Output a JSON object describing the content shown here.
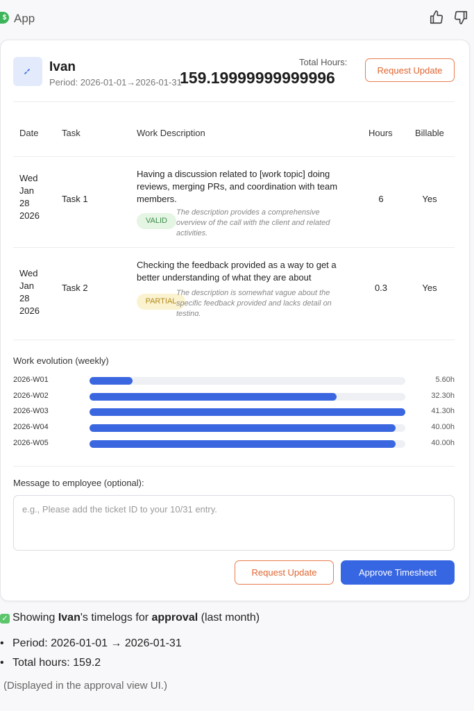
{
  "app": {
    "name": "App",
    "logo_letter": "$"
  },
  "header": {
    "employee_name": "Ivan",
    "period": "Period: 2026-01-01→2026-01-31",
    "total_label": "Total Hours:",
    "total_value": "159.19999999999996",
    "request_update_label": "Request Update"
  },
  "table": {
    "columns": [
      "Date",
      "Task",
      "Work Description",
      "Hours",
      "Billable"
    ],
    "rows": [
      {
        "date_lines": [
          "Wed",
          "Jan",
          "28",
          "2026"
        ],
        "task": "Task 1",
        "description": "Having a discussion related to [work topic] doing reviews, merging PRs, and coordination with team members.",
        "hours": "6",
        "billable": "Yes",
        "badge": "VALID",
        "note": "The description provides a comprehensive overview of the call with the client and related activities."
      },
      {
        "date_lines": [
          "Wed",
          "Jan",
          "28",
          "2026"
        ],
        "task": "Task 2",
        "description": "Checking the feedback provided as a way to get a better understanding of what they are about",
        "hours": "0.3",
        "billable": "Yes",
        "badge": "PARTIAL",
        "note": "The description is somewhat vague about the specific feedback provided and lacks detail on testing."
      }
    ]
  },
  "evolution": {
    "title": "Work evolution (weekly)",
    "max_hours": 41.3,
    "weeks": [
      {
        "label": "2026-W01",
        "hours": 5.6,
        "value_text": "5.60h"
      },
      {
        "label": "2026-W02",
        "hours": 32.3,
        "value_text": "32.30h"
      },
      {
        "label": "2026-W03",
        "hours": 41.3,
        "value_text": "41.30h"
      },
      {
        "label": "2026-W04",
        "hours": 40.0,
        "value_text": "40.00h"
      },
      {
        "label": "2026-W05",
        "hours": 40.0,
        "value_text": "40.00h"
      }
    ]
  },
  "message": {
    "label": "Message to employee (optional):",
    "placeholder": "e.g., Please add the ticket ID to your 10/31 entry."
  },
  "actions": {
    "request_update_label": "Request Update",
    "approve_label": "Approve Timesheet"
  },
  "summary": {
    "intro_prefix": "Showing ",
    "intro_name": "Ivan",
    "intro_mid": "'s timelogs for ",
    "intro_bold": "approval",
    "intro_suffix": " (last month)",
    "bullets": [
      "Period: 2026-01-01 → 2026-01-31",
      "Total hours: 159.2"
    ],
    "footnote": "(Displayed in the approval view UI.)"
  },
  "colors": {
    "accent": "#3766e2",
    "warning": "#e0642f",
    "valid": "#3a8c45",
    "partial": "#b08a1c"
  }
}
